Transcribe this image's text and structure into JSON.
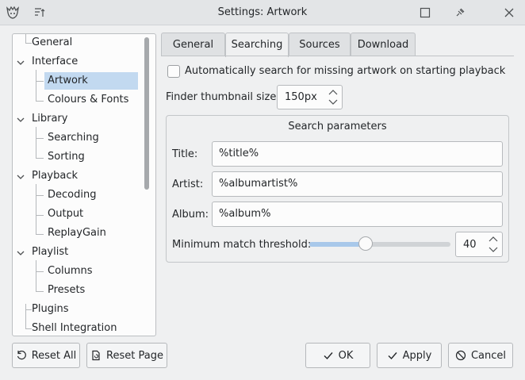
{
  "window": {
    "title": "Settings: Artwork"
  },
  "tree": {
    "items": [
      {
        "label": "General",
        "level": 0,
        "expandable": false
      },
      {
        "label": "Interface",
        "level": 0,
        "expandable": true
      },
      {
        "label": "Artwork",
        "level": 1,
        "selected": true
      },
      {
        "label": "Colours & Fonts",
        "level": 1
      },
      {
        "label": "Library",
        "level": 0,
        "expandable": true
      },
      {
        "label": "Searching",
        "level": 1
      },
      {
        "label": "Sorting",
        "level": 1
      },
      {
        "label": "Playback",
        "level": 0,
        "expandable": true
      },
      {
        "label": "Decoding",
        "level": 1
      },
      {
        "label": "Output",
        "level": 1
      },
      {
        "label": "ReplayGain",
        "level": 1
      },
      {
        "label": "Playlist",
        "level": 0,
        "expandable": true
      },
      {
        "label": "Columns",
        "level": 1
      },
      {
        "label": "Presets",
        "level": 1
      },
      {
        "label": "Plugins",
        "level": 0,
        "expandable": false
      },
      {
        "label": "Shell Integration",
        "level": 0,
        "expandable": false
      }
    ]
  },
  "tabs": [
    "General",
    "Searching",
    "Sources",
    "Download"
  ],
  "active_tab": "Searching",
  "auto_search": {
    "label": "Automatically search for missing artwork on starting playback",
    "checked": false
  },
  "thumbnail": {
    "label": "Finder thumbnail size:",
    "value": "150px"
  },
  "search_params": {
    "title": "Search parameters",
    "fields": [
      {
        "label": "Title:",
        "value": "%title%"
      },
      {
        "label": "Artist:",
        "value": "%albumartist%"
      },
      {
        "label": "Album:",
        "value": "%album%"
      }
    ],
    "threshold": {
      "label": "Minimum match threshold:",
      "value": "40",
      "slider_fraction": 0.4
    }
  },
  "buttons": {
    "reset_all": "Reset All",
    "reset_page": "Reset Page",
    "ok": "OK",
    "apply": "Apply",
    "cancel": "Cancel"
  }
}
